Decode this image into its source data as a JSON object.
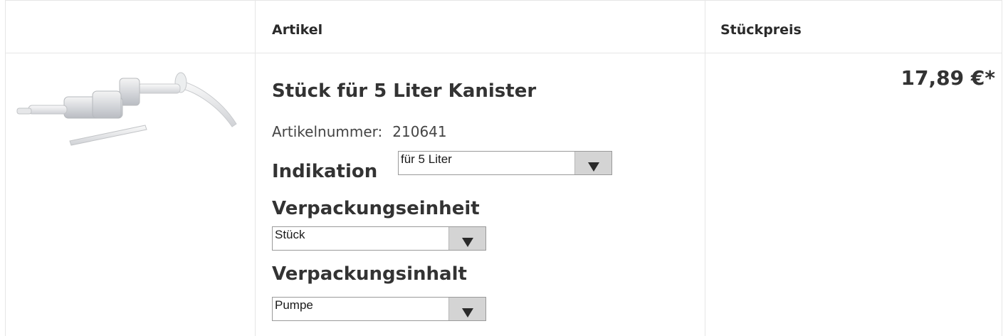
{
  "header": {
    "col_article": "Artikel",
    "col_unit_price": "Stückpreis"
  },
  "product": {
    "image_icon": "soap-dispenser-pump-image",
    "title": "Stück für 5 Liter Kanister",
    "article_number_label": "Artikelnummer:",
    "article_number": "210641",
    "indikation_label": "Indikation",
    "indikation_value": "für 5 Liter",
    "verpackungseinheit_label": "Verpackungseinheit",
    "verpackungseinheit_value": "Stück",
    "verpackungsinhalt_label": "Verpackungsinhalt",
    "verpackungsinhalt_value": "Pumpe",
    "price": "17,89 €*"
  },
  "colors": {
    "border": "#e6e6e6",
    "text": "#333333",
    "select_button": "#d4d4d4"
  }
}
